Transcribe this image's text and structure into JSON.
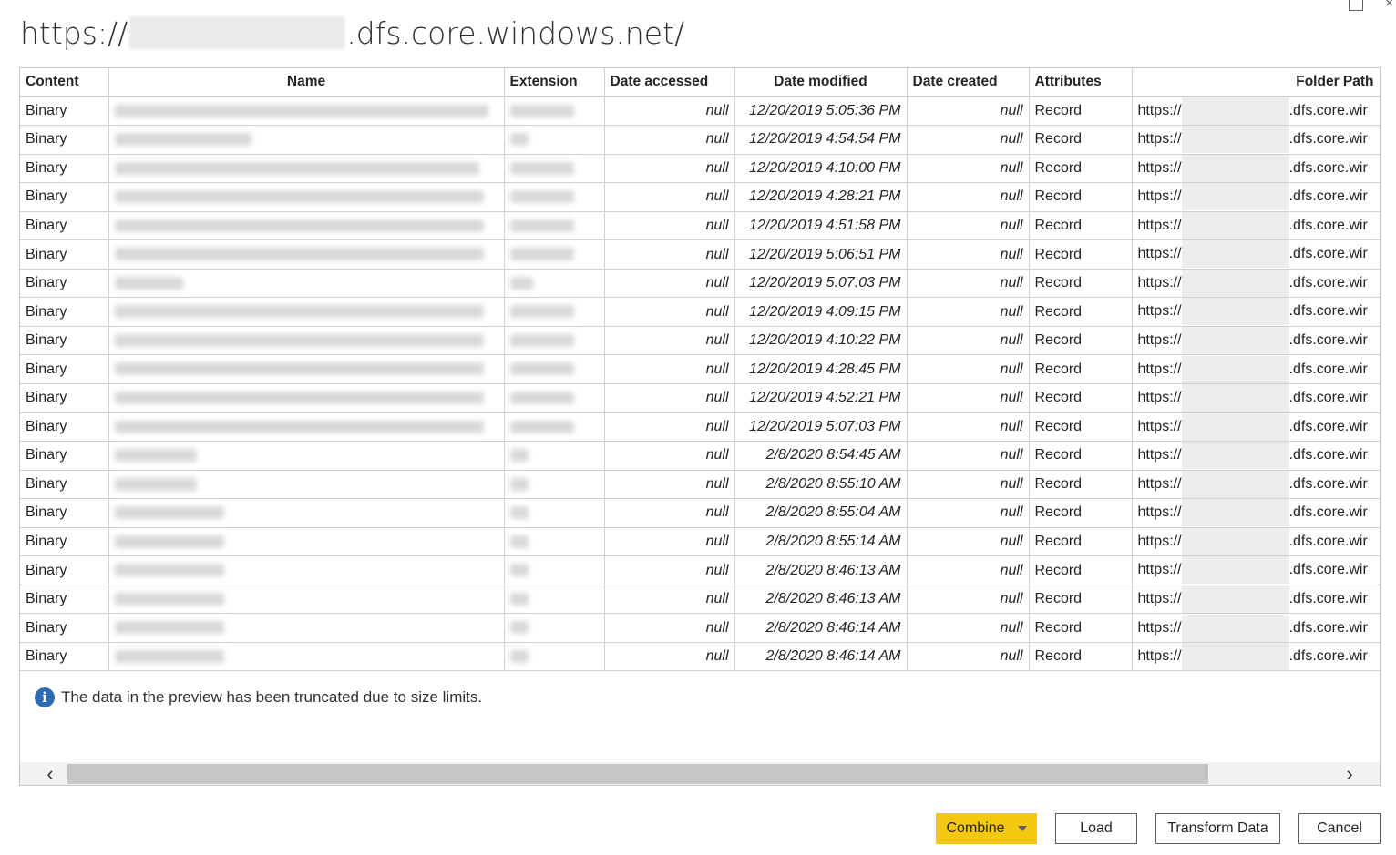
{
  "window": {
    "maximize_icon": "maximize-icon",
    "close_icon": "close-icon"
  },
  "title": {
    "prefix": "https://",
    "suffix": ".dfs.core.windows.net/"
  },
  "table": {
    "columns": [
      "Content",
      "Name",
      "Extension",
      "Date accessed",
      "Date modified",
      "Date created",
      "Attributes",
      "Folder Path"
    ],
    "rows": [
      {
        "content": "Binary",
        "date_accessed": "null",
        "date_modified": "12/20/2019 5:05:36 PM",
        "date_created": "null",
        "attributes": "Record",
        "folder_prefix": "https://",
        "folder_suffix": ".dfs.core.wir"
      },
      {
        "content": "Binary",
        "date_accessed": "null",
        "date_modified": "12/20/2019 4:54:54 PM",
        "date_created": "null",
        "attributes": "Record",
        "folder_prefix": "https://",
        "folder_suffix": ".dfs.core.wir"
      },
      {
        "content": "Binary",
        "date_accessed": "null",
        "date_modified": "12/20/2019 4:10:00 PM",
        "date_created": "null",
        "attributes": "Record",
        "folder_prefix": "https://",
        "folder_suffix": ".dfs.core.wir"
      },
      {
        "content": "Binary",
        "date_accessed": "null",
        "date_modified": "12/20/2019 4:28:21 PM",
        "date_created": "null",
        "attributes": "Record",
        "folder_prefix": "https://",
        "folder_suffix": ".dfs.core.wir"
      },
      {
        "content": "Binary",
        "date_accessed": "null",
        "date_modified": "12/20/2019 4:51:58 PM",
        "date_created": "null",
        "attributes": "Record",
        "folder_prefix": "https://",
        "folder_suffix": ".dfs.core.wir"
      },
      {
        "content": "Binary",
        "date_accessed": "null",
        "date_modified": "12/20/2019 5:06:51 PM",
        "date_created": "null",
        "attributes": "Record",
        "folder_prefix": "https://",
        "folder_suffix": ".dfs.core.wir"
      },
      {
        "content": "Binary",
        "date_accessed": "null",
        "date_modified": "12/20/2019 5:07:03 PM",
        "date_created": "null",
        "attributes": "Record",
        "folder_prefix": "https://",
        "folder_suffix": ".dfs.core.wir"
      },
      {
        "content": "Binary",
        "date_accessed": "null",
        "date_modified": "12/20/2019 4:09:15 PM",
        "date_created": "null",
        "attributes": "Record",
        "folder_prefix": "https://",
        "folder_suffix": ".dfs.core.wir"
      },
      {
        "content": "Binary",
        "date_accessed": "null",
        "date_modified": "12/20/2019 4:10:22 PM",
        "date_created": "null",
        "attributes": "Record",
        "folder_prefix": "https://",
        "folder_suffix": ".dfs.core.wir"
      },
      {
        "content": "Binary",
        "date_accessed": "null",
        "date_modified": "12/20/2019 4:28:45 PM",
        "date_created": "null",
        "attributes": "Record",
        "folder_prefix": "https://",
        "folder_suffix": ".dfs.core.wir"
      },
      {
        "content": "Binary",
        "date_accessed": "null",
        "date_modified": "12/20/2019 4:52:21 PM",
        "date_created": "null",
        "attributes": "Record",
        "folder_prefix": "https://",
        "folder_suffix": ".dfs.core.wir"
      },
      {
        "content": "Binary",
        "date_accessed": "null",
        "date_modified": "12/20/2019 5:07:03 PM",
        "date_created": "null",
        "attributes": "Record",
        "folder_prefix": "https://",
        "folder_suffix": ".dfs.core.wir"
      },
      {
        "content": "Binary",
        "date_accessed": "null",
        "date_modified": "2/8/2020 8:54:45 AM",
        "date_created": "null",
        "attributes": "Record",
        "folder_prefix": "https://",
        "folder_suffix": ".dfs.core.wir"
      },
      {
        "content": "Binary",
        "date_accessed": "null",
        "date_modified": "2/8/2020 8:55:10 AM",
        "date_created": "null",
        "attributes": "Record",
        "folder_prefix": "https://",
        "folder_suffix": ".dfs.core.wir"
      },
      {
        "content": "Binary",
        "date_accessed": "null",
        "date_modified": "2/8/2020 8:55:04 AM",
        "date_created": "null",
        "attributes": "Record",
        "folder_prefix": "https://",
        "folder_suffix": ".dfs.core.wir"
      },
      {
        "content": "Binary",
        "date_accessed": "null",
        "date_modified": "2/8/2020 8:55:14 AM",
        "date_created": "null",
        "attributes": "Record",
        "folder_prefix": "https://",
        "folder_suffix": ".dfs.core.wir"
      },
      {
        "content": "Binary",
        "date_accessed": "null",
        "date_modified": "2/8/2020 8:46:13 AM",
        "date_created": "null",
        "attributes": "Record",
        "folder_prefix": "https://",
        "folder_suffix": ".dfs.core.wir"
      },
      {
        "content": "Binary",
        "date_accessed": "null",
        "date_modified": "2/8/2020 8:46:13 AM",
        "date_created": "null",
        "attributes": "Record",
        "folder_prefix": "https://",
        "folder_suffix": ".dfs.core.wir"
      },
      {
        "content": "Binary",
        "date_accessed": "null",
        "date_modified": "2/8/2020 8:46:14 AM",
        "date_created": "null",
        "attributes": "Record",
        "folder_prefix": "https://",
        "folder_suffix": ".dfs.core.wir"
      },
      {
        "content": "Binary",
        "date_accessed": "null",
        "date_modified": "2/8/2020 8:46:14 AM",
        "date_created": "null",
        "attributes": "Record",
        "folder_prefix": "https://",
        "folder_suffix": ".dfs.core.wir"
      }
    ]
  },
  "info": {
    "icon": "info-icon",
    "message": "The data in the preview has been truncated due to size limits."
  },
  "scrollbar": {
    "left_icon": "chevron-left-icon",
    "right_icon": "chevron-right-icon"
  },
  "buttons": {
    "combine": "Combine",
    "combine_icon": "caret-down-icon",
    "load": "Load",
    "transform": "Transform Data",
    "cancel": "Cancel"
  },
  "colors": {
    "accent": "#f2c811",
    "info_blue": "#2f6bb3"
  }
}
